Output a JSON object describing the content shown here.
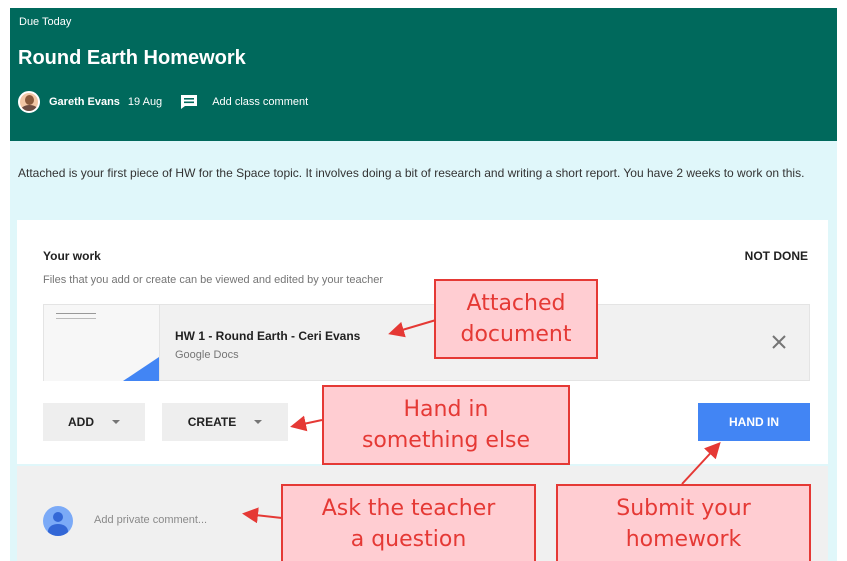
{
  "header": {
    "due_label": "Due Today",
    "title": "Round Earth Homework",
    "author": "Gareth Evans",
    "date": "19 Aug",
    "class_comment_label": "Add class comment"
  },
  "description": "Attached is your first piece of HW for the Space topic. It involves doing a bit of research and writing a short report. You have 2 weeks to work on this.",
  "your_work": {
    "heading": "Your work",
    "status": "NOT DONE",
    "hint": "Files that you add or create can be viewed and edited by your teacher",
    "attachment": {
      "title": "HW 1 - Round Earth - Ceri Evans",
      "type": "Google Docs"
    },
    "add_label": "ADD",
    "create_label": "CREATE",
    "hand_in_label": "HAND IN"
  },
  "private_comment": {
    "placeholder": "Add private comment..."
  },
  "annotations": {
    "attached_line1": "Attached",
    "attached_line2": "document",
    "handin_line1": "Hand in",
    "handin_line2": "something else",
    "ask_line1": "Ask the teacher",
    "ask_line2": "a question",
    "submit_line1": "Submit your",
    "submit_line2": "homework"
  },
  "colors": {
    "header_bg": "#00695c",
    "page_bg": "#e0f7fa",
    "primary_button": "#4285f4",
    "callout_border": "#e53935",
    "callout_fill": "#ffcdd2"
  },
  "icons": {
    "author_avatar": "avatar",
    "class_comment": "comment-icon",
    "remove_attachment": "close-icon",
    "dropdown": "chevron-down-icon",
    "private_avatar": "user-avatar-icon"
  }
}
